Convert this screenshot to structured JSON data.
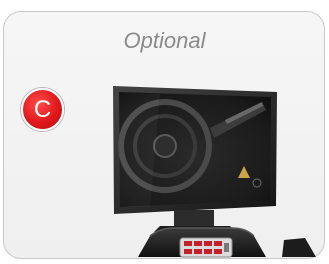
{
  "heading": "Optional",
  "badge_letter": "C",
  "colors": {
    "badge": "#e0191b",
    "title": "#8a8a8a",
    "card_border": "#c7c7c7"
  },
  "icons": [
    "monitor-screen",
    "device-console",
    "control-keypad"
  ]
}
